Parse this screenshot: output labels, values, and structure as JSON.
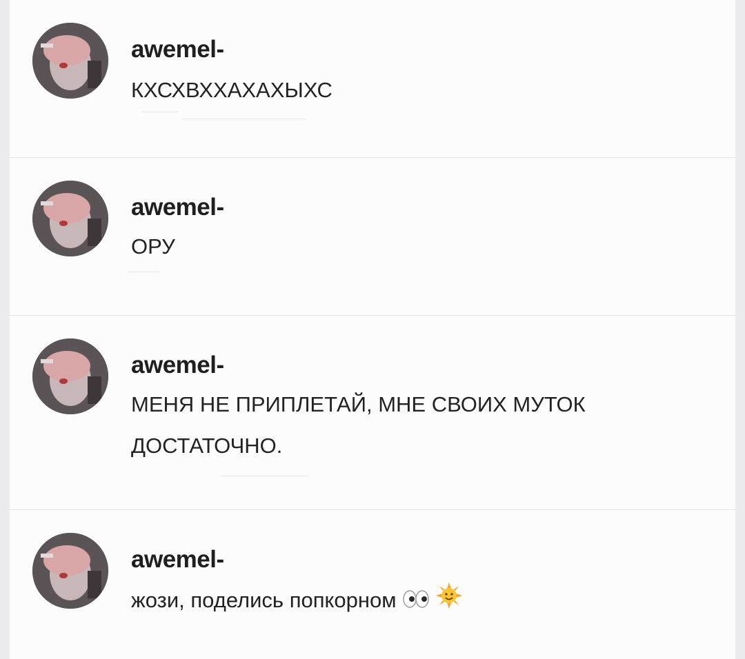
{
  "comments": [
    {
      "username": "awemel-",
      "text": "КХСХВХХАХАХЫХС"
    },
    {
      "username": "awemel-",
      "text": "ОРУ"
    },
    {
      "username": "awemel-",
      "text_line1": "МЕНЯ НЕ ПРИПЛЕТАЙ, МНЕ СВОИХ МУТОК",
      "text_line2": "ДОСТАТОЧНО."
    },
    {
      "username": "awemel-",
      "text": "жози, поделись попкорном"
    }
  ],
  "icons": {
    "eyes": "eyes-emoji",
    "sun": "sun-emoji"
  },
  "colors": {
    "background": "#fdfcfd",
    "text": "#222222",
    "divider": "#e4e3e6"
  }
}
